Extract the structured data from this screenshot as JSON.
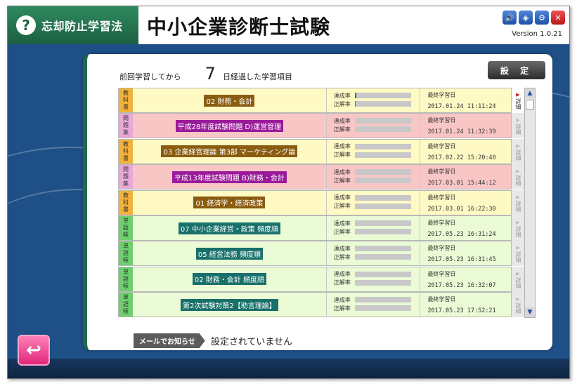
{
  "header": {
    "app_name": "忘却防止学習法",
    "help_icon_glyph": "?",
    "exam_title": "中小企業診断士試験",
    "version": "Version 1.0.21",
    "buttons": [
      {
        "name": "sound-icon",
        "glyph": "🔊"
      },
      {
        "name": "cube-icon",
        "glyph": "◈"
      },
      {
        "name": "gear-icon",
        "glyph": "⚙"
      },
      {
        "name": "close-icon",
        "glyph": "✕"
      }
    ]
  },
  "summary": {
    "prefix": "前回学習してから",
    "days": "7",
    "suffix": "日経過した学習項目"
  },
  "settings_label": "設 定",
  "stats_labels": {
    "achievement": "達成率",
    "correct": "正解率"
  },
  "last_study_label": "最終学習日",
  "detail_label": "詳細",
  "rows": [
    {
      "kind": "textbook",
      "tag": [
        "教",
        "科",
        "書"
      ],
      "subject": "02 財務・会計",
      "achievement": 0.03,
      "correct": 0.02,
      "date": "2017.01.24 11:11:24",
      "detail_active": true
    },
    {
      "kind": "exam",
      "tag": [
        "問",
        "題",
        "集"
      ],
      "subject": "平成28年度試験問題 D)運営管理",
      "achievement": 0,
      "correct": 0,
      "date": "2017.01.24 11:32:39",
      "detail_active": false
    },
    {
      "kind": "textbook",
      "tag": [
        "教",
        "科",
        "書"
      ],
      "subject": "03 企業経営理論 第3部 マーケティング論",
      "achievement": 0,
      "correct": 0,
      "date": "2017.02.22 15:20:48",
      "detail_active": false
    },
    {
      "kind": "exam",
      "tag": [
        "問",
        "題",
        "集"
      ],
      "subject": "平成13年度試験問題 B)財務・会計",
      "achievement": 0,
      "correct": 0,
      "date": "2017.03.01 15:44:12",
      "detail_active": false
    },
    {
      "kind": "textbook",
      "tag": [
        "教",
        "科",
        "書"
      ],
      "subject": "01 経済学・経済政策",
      "achievement": 0,
      "correct": 0,
      "date": "2017.03.01 16:22:30",
      "detail_active": false
    },
    {
      "kind": "vocab",
      "tag": [
        "単",
        "語",
        "帳"
      ],
      "subject": "07 中小企業経営・政策 頻度順",
      "achievement": 0,
      "correct": 0,
      "date": "2017.05.23 16:31:24",
      "detail_active": false
    },
    {
      "kind": "vocab",
      "tag": [
        "単",
        "語",
        "帳"
      ],
      "subject": "05 経営法務 頻度順",
      "achievement": 0,
      "correct": 0,
      "date": "2017.05.23 16:31:45",
      "detail_active": false
    },
    {
      "kind": "vocab",
      "tag": [
        "単",
        "語",
        "帳"
      ],
      "subject": "02 財務・会計 頻度順",
      "achievement": 0,
      "correct": 0,
      "date": "2017.05.23 16:32:07",
      "detail_active": false
    },
    {
      "kind": "vocab",
      "tag": [
        "単",
        "語",
        "帳"
      ],
      "subject": "第2次試験対策2【助言理論】",
      "achievement": 0,
      "correct": 0,
      "date": "2017.05.23 17:52:21",
      "detail_active": false
    }
  ],
  "mail": {
    "label": "メールでお知らせ",
    "status": "設定されていません"
  },
  "back_glyph": "↩",
  "colors": {
    "brand_green": "#1f6a45",
    "background_blue": "#1e4f86",
    "textbook_row": "#fff9c4",
    "exam_row": "#f9c6c6",
    "vocab_row": "#eafbd5"
  }
}
